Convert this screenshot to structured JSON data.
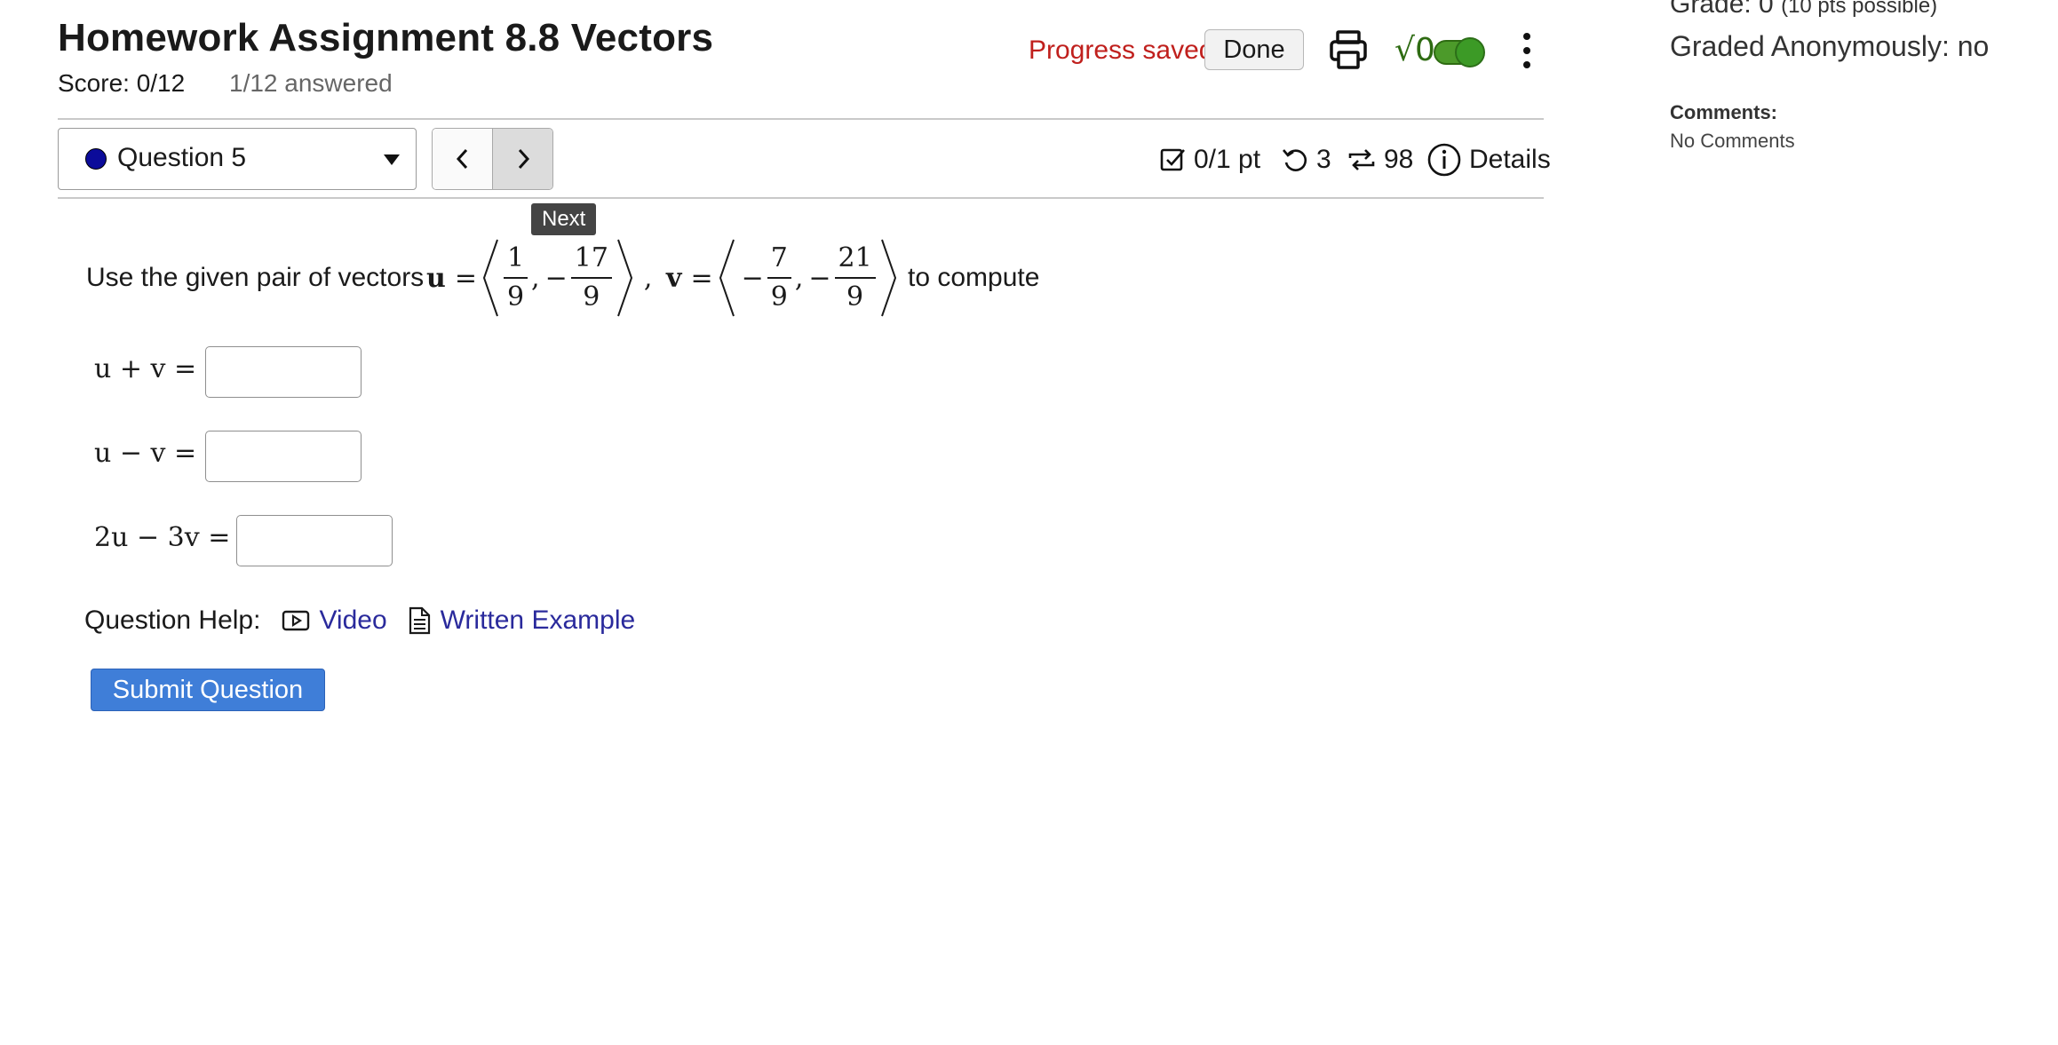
{
  "header": {
    "title": "Homework Assignment 8.8 Vectors",
    "score": "Score: 0/12",
    "answered": "1/12 answered",
    "progress_status": "Progress saved",
    "done_label": "Done",
    "sqrt_label": "√0",
    "accent_color": "#3f7ed8",
    "status_color": "#c0201d",
    "toggle_color": "#4c9a2a"
  },
  "question_nav": {
    "selected": "Question 5",
    "tooltip": "Next"
  },
  "meta": {
    "points": "0/1 pt",
    "retries": "3",
    "attempts": "98",
    "details_label": "Details"
  },
  "question": {
    "intro": "Use the given pair of vectors",
    "u_symbol": "u",
    "v_symbol": "v",
    "u": {
      "x_num": "1",
      "x_den": "9",
      "y_sign": "−",
      "y_num": "17",
      "y_den": "9"
    },
    "v": {
      "x_sign": "−",
      "x_num": "7",
      "x_den": "9",
      "y_sign": "−",
      "y_num": "21",
      "y_den": "9"
    },
    "outro": "to compute",
    "parts": [
      {
        "expr": "u + v ="
      },
      {
        "expr": "u − v ="
      },
      {
        "expr": "2u − 3v ="
      }
    ]
  },
  "help": {
    "label": "Question Help:",
    "video": "Video",
    "written": "Written Example"
  },
  "submit_label": "Submit Question",
  "sidebar": {
    "grade_main": "Grade: 0",
    "grade_possible": "(10 pts possible)",
    "anonymous": "Graded Anonymously: no",
    "comments_header": "Comments:",
    "comments_body": "No Comments"
  }
}
